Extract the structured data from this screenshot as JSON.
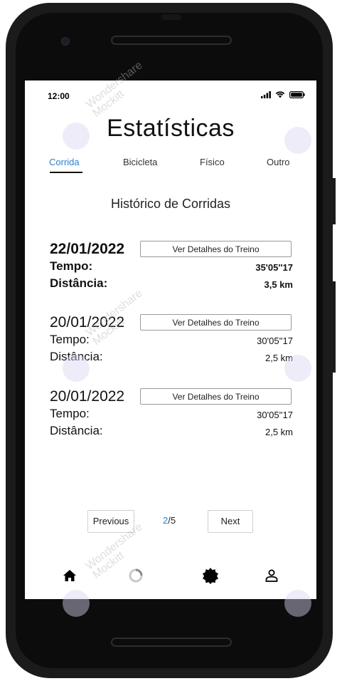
{
  "status_bar": {
    "time": "12:00"
  },
  "page": {
    "title": "Estatísticas"
  },
  "tabs": [
    {
      "label": "Corrida",
      "active": true
    },
    {
      "label": "Bicicleta",
      "active": false
    },
    {
      "label": "Físico",
      "active": false
    },
    {
      "label": "Outro",
      "active": false
    }
  ],
  "section_title": "Histórico de Corridas",
  "history": [
    {
      "date": "22/01/2022",
      "time_label": "Tempo:",
      "time_value": "35'05''17",
      "distance_label": "Distância:",
      "distance_value": "3,5 km",
      "button_label": "Ver Detalhes do Treino"
    },
    {
      "date": "20/01/2022",
      "time_label": "Tempo:",
      "time_value": "30'05''17",
      "distance_label": "Distância:",
      "distance_value": "2,5 km",
      "button_label": "Ver Detalhes do Treino"
    },
    {
      "date": "20/01/2022",
      "time_label": "Tempo:",
      "time_value": "30'05''17",
      "distance_label": "Distância:",
      "distance_value": "2,5 km",
      "button_label": "Ver Detalhes do Treino"
    }
  ],
  "pagination": {
    "previous_label": "Previous",
    "current": "2",
    "separator": "/",
    "total": "5",
    "next_label": "Next"
  },
  "bottom_nav": [
    {
      "icon": "home-icon"
    },
    {
      "icon": "loading-ring-icon"
    },
    {
      "icon": "badge-icon"
    },
    {
      "icon": "user-icon"
    }
  ],
  "watermark": {
    "line1": "Wondershare",
    "line2": "Mockitt"
  },
  "colors": {
    "accent": "#2f7fd0",
    "text": "#111111",
    "frame": "#1b1b1b"
  }
}
